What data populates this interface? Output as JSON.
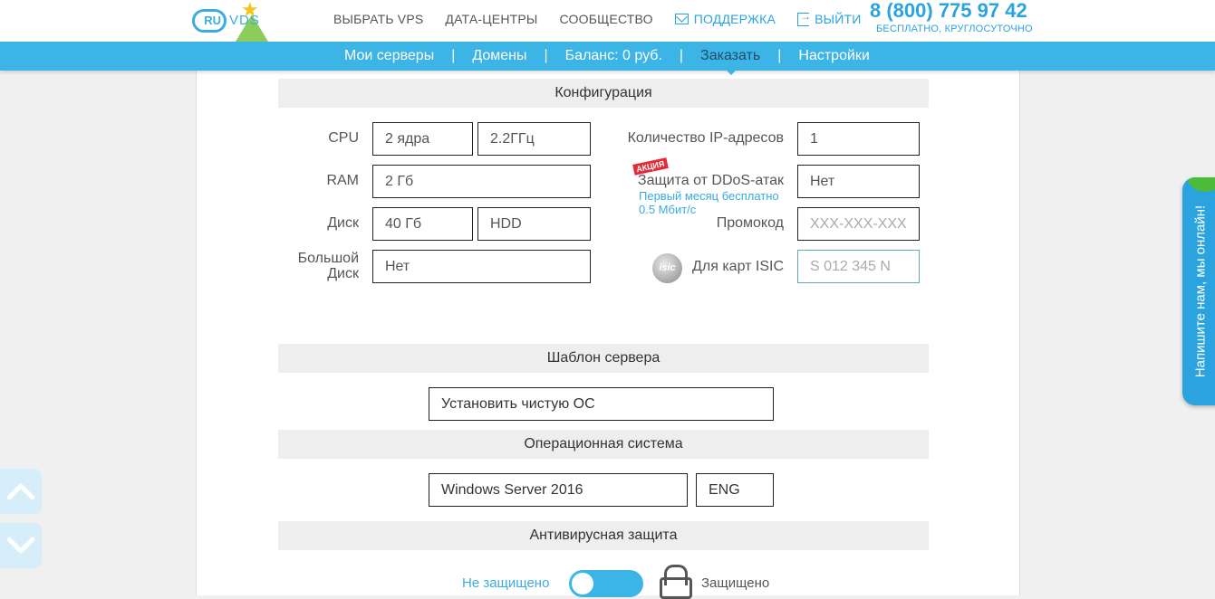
{
  "header": {
    "logo_text_ru": "RU",
    "logo_text_vds": "VDS",
    "nav": [
      {
        "label": "ВЫБРАТЬ VPS"
      },
      {
        "label": "ДАТА-ЦЕНТРЫ"
      },
      {
        "label": "СООБЩЕСТВО"
      },
      {
        "label": "ПОДДЕРЖКА",
        "icon": "mail-icon"
      },
      {
        "label": "ВЫЙТИ",
        "icon": "exit-icon"
      }
    ],
    "phone": "8 (800) 775 97 42",
    "phone_note": "БЕСПЛАТНО, КРУГЛОСУТОЧНО",
    "accent_color": "#2aa3df"
  },
  "subnav": {
    "items": [
      "Мои серверы",
      "Домены",
      "Баланс: 0 руб.",
      "Заказать",
      "Настройки"
    ],
    "active": "Заказать",
    "separator": "|"
  },
  "config": {
    "title": "Конфигурация",
    "cpu_label": "CPU",
    "cpu_cores": "2 ядра",
    "cpu_freq": "2.2ГГц",
    "ram_label": "RAM",
    "ram_value": "2 Гб",
    "disk_label": "Диск",
    "disk_size": "40 Гб",
    "disk_type": "HDD",
    "bigdisk_label_1": "Большой",
    "bigdisk_label_2": "Диск",
    "bigdisk_value": "Нет",
    "ip_label": "Количество IP-адресов",
    "ip_value": "1",
    "ddos_badge": "АКЦИЯ",
    "ddos_label": "Защита от DDoS-атак",
    "ddos_value": "Нет",
    "ddos_note_1": "Первый месяц бесплатно",
    "ddos_note_2": "0.5 Мбит/с",
    "promo_label": "Промокод",
    "promo_placeholder": "XXX-XXX-XXX",
    "isic_badge": "isic",
    "isic_label": "Для карт ISIC",
    "isic_placeholder": "S 012 345 N"
  },
  "template": {
    "title": "Шаблон сервера",
    "value": "Установить чистую ОС"
  },
  "os": {
    "title": "Операционная система",
    "value": "Windows Server 2016",
    "lang": "ENG"
  },
  "antivirus": {
    "title": "Антивирусная защита",
    "left_label": "Не защищено",
    "right_label": "Защищено"
  },
  "chat": {
    "label": "Напишите нам, мы онлайн!"
  }
}
